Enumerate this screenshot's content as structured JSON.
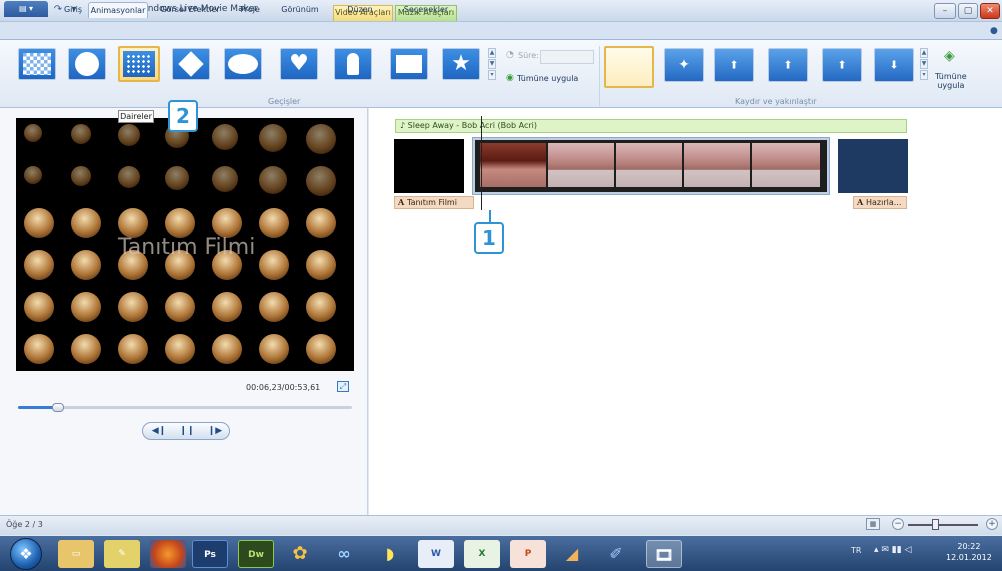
{
  "window": {
    "title": "Filmim - Windows Live Movie Maker",
    "ctx_video": "Video Araçları",
    "ctx_audio": "Müzik Araçları"
  },
  "tabs": [
    {
      "label": "Giriş"
    },
    {
      "label": "Animasyonlar"
    },
    {
      "label": "Görsel Efektler"
    },
    {
      "label": "Proje"
    },
    {
      "label": "Görünüm"
    },
    {
      "label": "Düzen"
    },
    {
      "label": "Seçenekler"
    }
  ],
  "ribbon": {
    "group_transitions": "Geçişler",
    "group_pan": "Kaydır ve yakınlaştır",
    "duration_label": "Süre:",
    "apply_all": "Tümüne uygula",
    "apply_all_pan_1": "Tümüne",
    "apply_all_pan_2": "uygula",
    "transition_icons": [
      "checker-icon",
      "circle-icon",
      "dots-icon",
      "diamond-icon",
      "ellipse-icon",
      "heart-icon",
      "keyhole-icon",
      "rectangle-icon",
      "star-icon"
    ]
  },
  "tooltip": "Daireler",
  "preview": {
    "caption": "Tanıtım Filmi",
    "timecode": "00:06,23/00:53,61",
    "progress": 0.12
  },
  "timeline": {
    "audio_track": "Sleep Away - Bob Acri (Bob Acri)",
    "caption1": "Tanıtım Filmi",
    "caption2": "Hazırla..."
  },
  "callouts": {
    "one": "1",
    "two": "2"
  },
  "status": {
    "item_count": "Öğe 2 / 3"
  },
  "taskbar": {
    "lang": "TR",
    "time": "20:22",
    "date": "12.01.2012",
    "ps_label": "Ps",
    "dw_label": "Dw"
  },
  "colors": {
    "accent": "#2e94d6",
    "selection": "#e4b64b"
  }
}
